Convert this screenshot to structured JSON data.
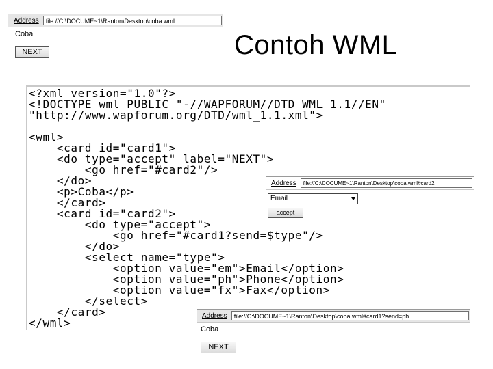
{
  "slide": {
    "title": "Contoh WML"
  },
  "browser1": {
    "address_label": "Address",
    "address_value": "file://C:\\DOCUME~1\\Ranton\\Desktop\\coba.wml",
    "page_text": "Coba",
    "button_label": "NEXT"
  },
  "browser2": {
    "address_label": "Address",
    "address_value": "file://C:\\DOCUME~1\\Ranton\\Desktop\\coba.wml#card2",
    "select_value": "Email",
    "button_label": "accept"
  },
  "browser3": {
    "address_label": "Address",
    "address_value": "file://C:\\DOCUME~1\\Ranton\\Desktop\\coba.wml#card1?send=ph",
    "page_text": "Coba",
    "button_label": "NEXT"
  },
  "code": {
    "lines": [
      "<?xml version=\"1.0\"?>",
      "<!DOCTYPE wml PUBLIC \"-//WAPFORUM//DTD WML 1.1//EN\"",
      "\"http://www.wapforum.org/DTD/wml_1.1.xml\">",
      "",
      "<wml>",
      "    <card id=\"card1\">",
      "    <do type=\"accept\" label=\"NEXT\">",
      "        <go href=\"#card2\"/>",
      "    </do>",
      "    <p>Coba</p>",
      "    </card>",
      "    <card id=\"card2\">",
      "        <do type=\"accept\">",
      "            <go href=\"#card1?send=$type\"/>",
      "        </do>",
      "        <select name=\"type\">",
      "            <option value=\"em\">Email</option>",
      "            <option value=\"ph\">Phone</option>",
      "            <option value=\"fx\">Fax</option>",
      "        </select>",
      "    </card>",
      "</wml>"
    ]
  }
}
